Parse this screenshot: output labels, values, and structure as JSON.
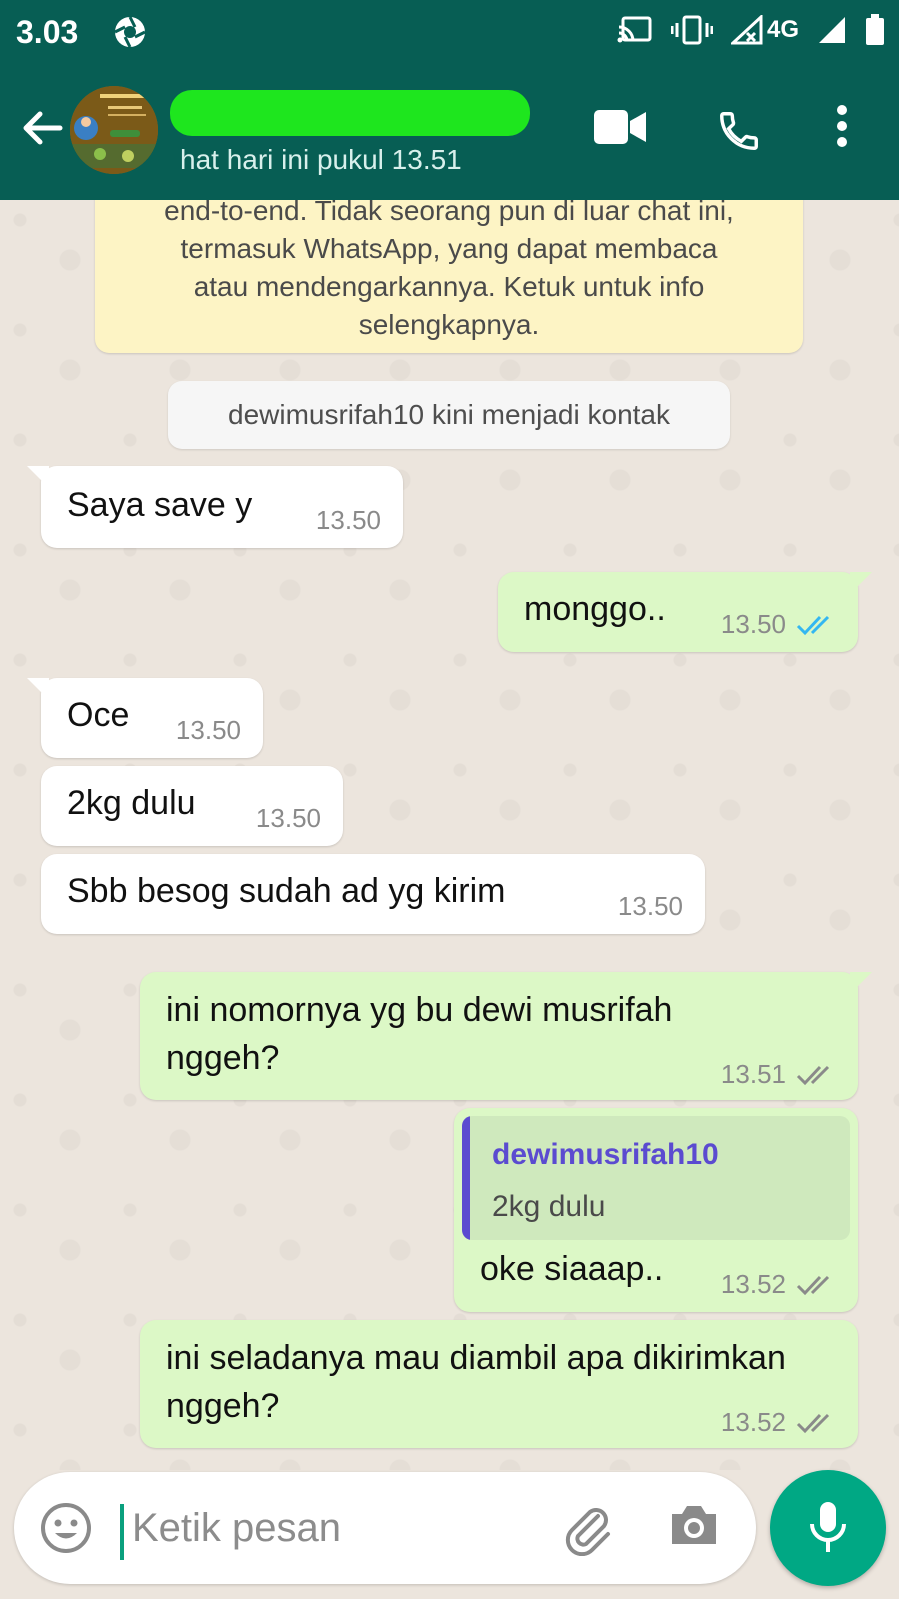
{
  "status_bar": {
    "time": "3.03",
    "network": "4G"
  },
  "header": {
    "last_seen": "hat hari ini pukul 13.51"
  },
  "notice": {
    "lines": [
      "end-to-end. Tidak seorang pun di luar chat ini,",
      "termasuk WhatsApp, yang dapat membaca",
      "atau mendengarkannya. Ketuk untuk info",
      "selengkapnya."
    ]
  },
  "system_message": "dewimusrifah10 kini menjadi kontak",
  "messages": [
    {
      "direction": "in",
      "text": "Saya save y",
      "time": "13.50"
    },
    {
      "direction": "out",
      "text": "monggo..",
      "time": "13.50",
      "ticks": "read"
    },
    {
      "direction": "in",
      "text": "Oce",
      "time": "13.50"
    },
    {
      "direction": "in",
      "text": "2kg dulu",
      "time": "13.50"
    },
    {
      "direction": "in",
      "text": "Sbb besog sudah ad yg kirim",
      "time": "13.50"
    },
    {
      "direction": "out",
      "text": "ini nomornya yg bu dewi musrifah nggeh?",
      "time": "13.51",
      "ticks": "delivered"
    },
    {
      "direction": "out",
      "reply_to": {
        "author": "dewimusrifah10",
        "text": "2kg dulu"
      },
      "text": "oke siaaap..",
      "time": "13.52",
      "ticks": "delivered"
    },
    {
      "direction": "out",
      "text": "ini seladanya mau diambil apa dikirimkan nggeh?",
      "time": "13.52",
      "ticks": "delivered"
    }
  ],
  "composer": {
    "placeholder": "Ketik pesan"
  },
  "colors": {
    "header": "#075e54",
    "outgoing_bubble": "#dcf8c6",
    "incoming_bubble": "#ffffff",
    "read_ticks": "#34b7f1",
    "mic_button": "#00a884"
  }
}
